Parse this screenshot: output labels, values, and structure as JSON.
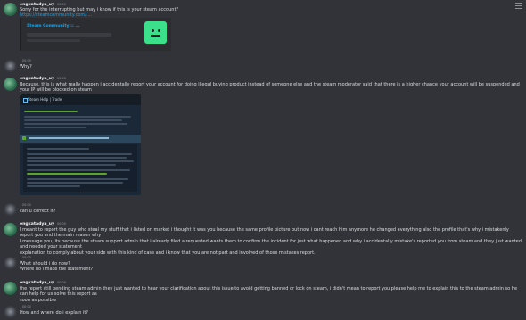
{
  "messages": [
    {
      "author": "engkatadya_uy",
      "time": "00:00",
      "avatar": "green",
      "lines": [
        "Sorry for the interrupting but may i know if this is your steam account?"
      ],
      "link": "https://steamcommunity.com/...."
    },
    {
      "author": "",
      "time": "00:00",
      "avatar": "dark",
      "lines": [
        "Why?"
      ]
    },
    {
      "author": "engkatadya_uy",
      "time": "00:00",
      "avatar": "green",
      "lines": [
        "Because, this is what really happen i accidentally report your account for doing illegal buying product instead of someone else and the steam moderator said that there is a higher chance your account will be suspended and your IP will be blocked on steam",
        "if there is no action."
      ]
    },
    {
      "author": "",
      "time": "00:00",
      "avatar": "dark",
      "lines": [
        "can u correct it?"
      ]
    },
    {
      "author": "engkatadya_uy",
      "time": "00:00",
      "avatar": "green",
      "lines": [
        "I meant to report the guy who steal my stuff that i listed on market i thought it was you because the same profile picture but now i cant reach him anymore he changed everything also the profile that's why i mistakenly report you and the main reason why",
        "I message you, its because the steam support admin that i already filed a requested wants them to confirm the incident for just what happened and why i accidentally mistake's reported you from steam and they just wanted and needed your statement",
        "explanation to comply about your side with this kind of case and i know that you are not part and involved of those mistakes report."
      ]
    },
    {
      "author": "",
      "time": "00:00",
      "avatar": "dark",
      "lines": [
        "What should i do now?",
        "Where do i make the statement?"
      ]
    },
    {
      "author": "engkatadya_uy",
      "time": "00:00",
      "avatar": "green",
      "lines": [
        "the report still pending steam admin they just wanted to hear your clarification about this issue to avoid getting banned or lock on steam, i didn't mean to report you please help me to explain this to the steam admin so he can help for us solve this report as",
        "soon as possible"
      ]
    },
    {
      "author": "",
      "time": "00:00",
      "avatar": "dark",
      "lines": [
        "How and where do i explain it?"
      ]
    }
  ],
  "embed": {
    "title": "Steam Community :: ..."
  },
  "screenshot": {
    "title": "Steam Help | Trade"
  },
  "colors": {
    "background": "#313338",
    "link": "#00a8fc",
    "embed_logo": "#3ce08a"
  }
}
